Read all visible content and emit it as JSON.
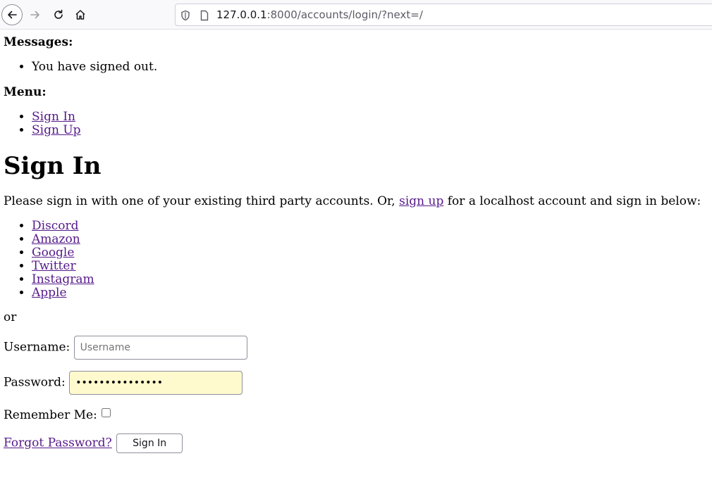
{
  "browser": {
    "url_host": "127.0.0.1",
    "url_rest": ":8000/accounts/login/?next=/"
  },
  "messages": {
    "heading": "Messages:",
    "items": [
      "You have signed out."
    ]
  },
  "menu": {
    "heading": "Menu:",
    "items": [
      "Sign In",
      "Sign Up"
    ]
  },
  "main": {
    "title": "Sign In",
    "intro_before": "Please sign in with one of your existing third party accounts. Or, ",
    "intro_link": "sign up",
    "intro_after": " for a localhost account and sign in below:",
    "providers": [
      "Discord",
      "Amazon",
      "Google",
      "Twitter",
      "Instagram",
      "Apple"
    ],
    "or_text": "or"
  },
  "form": {
    "username_label": "Username:",
    "username_placeholder": "Username",
    "username_value": "",
    "password_label": "Password:",
    "password_value": "•••••••••••••••",
    "remember_label": "Remember Me:",
    "remember_checked": false,
    "forgot_link": "Forgot Password?",
    "submit_label": "Sign In"
  }
}
